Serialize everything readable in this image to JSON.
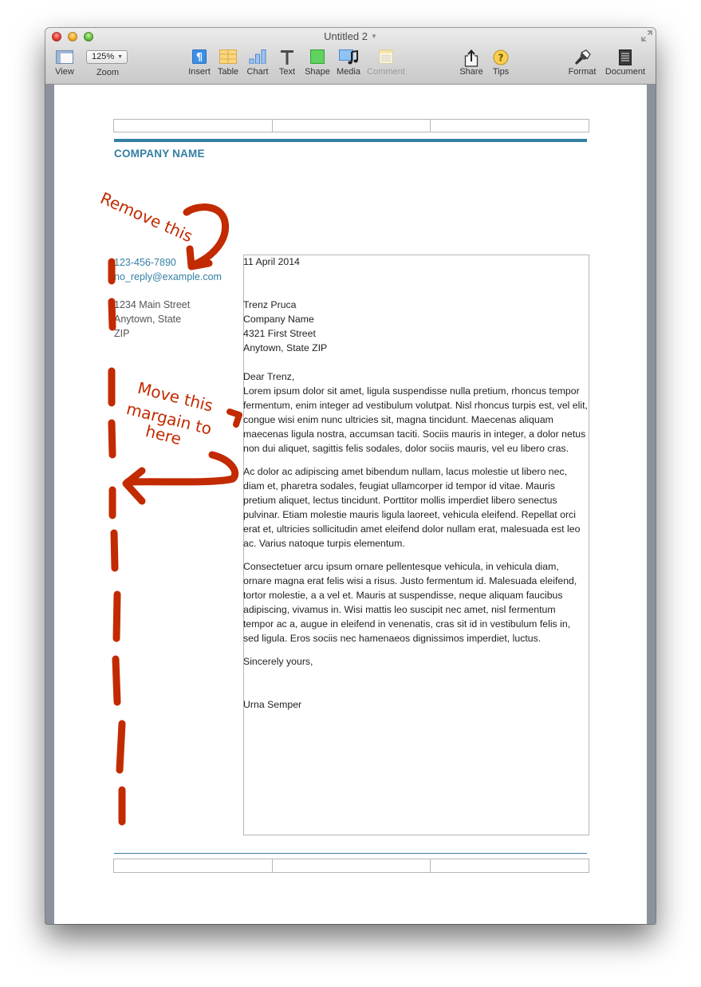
{
  "window": {
    "title": "Untitled 2",
    "title_menu_icon": "chevron-down-icon",
    "fullscreen_icon": "fullscreen-arrows-icon"
  },
  "toolbar": {
    "view": {
      "label": "View",
      "icon": "sidebar-view-icon"
    },
    "zoom": {
      "label": "Zoom",
      "value": "125%"
    },
    "insert": {
      "label": "Insert",
      "icon": "pilcrow-icon"
    },
    "table": {
      "label": "Table",
      "icon": "table-icon"
    },
    "chart": {
      "label": "Chart",
      "icon": "bar-chart-icon"
    },
    "text": {
      "label": "Text",
      "icon": "text-t-icon"
    },
    "shape": {
      "label": "Shape",
      "icon": "square-shape-icon"
    },
    "media": {
      "label": "Media",
      "icon": "media-music-icon"
    },
    "comment": {
      "label": "Comment",
      "icon": "comment-note-icon",
      "enabled": false
    },
    "share": {
      "label": "Share",
      "icon": "share-icon"
    },
    "tips": {
      "label": "Tips",
      "icon": "question-icon"
    },
    "format": {
      "label": "Format",
      "icon": "paintbrush-icon"
    },
    "document": {
      "label": "Document",
      "icon": "document-icon"
    }
  },
  "colors": {
    "accent": "#357fa3",
    "annotation": "#c22a00",
    "table_border": "#b3b8bc"
  },
  "letter": {
    "company_name": "COMPANY NAME",
    "sender": {
      "phone": "123-456-7890",
      "email": "no_reply@example.com",
      "address_lines": [
        "1234 Main Street",
        "Anytown, State",
        "ZIP"
      ]
    },
    "date": "11 April 2014",
    "recipient_lines": [
      "Trenz Pruca",
      "Company Name",
      "4321 First Street",
      "Anytown, State ZIP"
    ],
    "salutation": "Dear Trenz,",
    "paragraphs": [
      "Lorem ipsum dolor sit amet, ligula suspendisse nulla pretium, rhoncus tempor fermentum, enim integer ad vestibulum volutpat. Nisl rhoncus turpis est, vel elit, congue wisi enim nunc ultricies sit, magna tincidunt. Maecenas aliquam maecenas ligula nostra, accumsan taciti. Sociis mauris in integer, a dolor netus non dui aliquet, sagittis felis sodales, dolor sociis mauris, vel eu libero cras.",
      "Ac dolor ac adipiscing amet bibendum nullam, lacus molestie ut libero nec, diam et, pharetra sodales, feugiat ullamcorper id tempor id vitae. Mauris pretium aliquet, lectus tincidunt. Porttitor mollis imperdiet libero senectus pulvinar. Etiam molestie mauris ligula laoreet, vehicula eleifend. Repellat orci erat et, ultricies sollicitudin amet eleifend dolor nullam erat, malesuada est leo ac. Varius natoque turpis elementum.",
      "Consectetuer arcu ipsum ornare pellentesque vehicula, in vehicula diam, ornare magna erat felis wisi a risus. Justo fermentum id. Malesuada eleifend, tortor molestie, a a vel et. Mauris at suspendisse, neque aliquam faucibus adipiscing, vivamus in. Wisi mattis leo suscipit nec amet, nisl fermentum tempor ac a, augue in eleifend in venenatis, cras sit id in vestibulum felis in, sed ligula. Eros sociis nec hamenaeos dignissimos imperdiet, luctus."
    ],
    "closing": "Sincerely yours,",
    "signature": "Urna Semper"
  },
  "annotations": {
    "remove_note": "Remove this",
    "move_note_lines": [
      "Move this",
      "margain to",
      "here"
    ]
  }
}
